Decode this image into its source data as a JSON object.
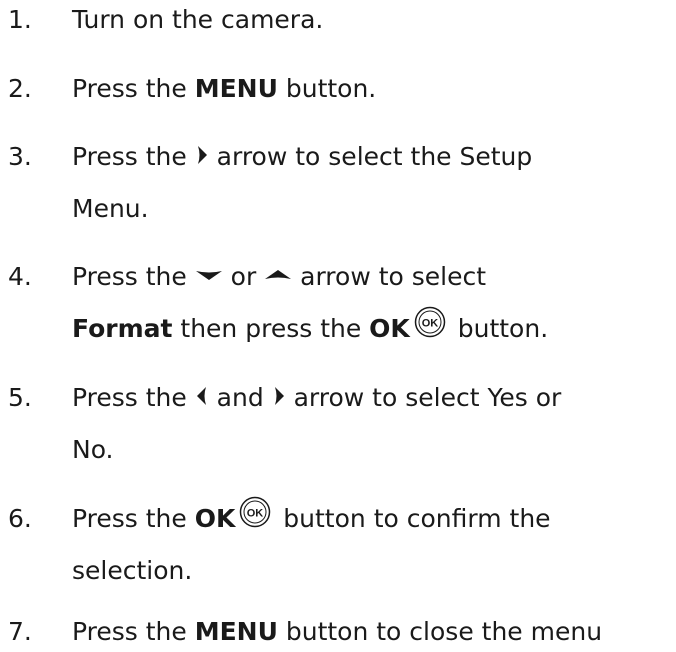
{
  "steps": [
    {
      "num": "1.",
      "line1": "Turn on the camera."
    },
    {
      "num": "2.",
      "pre": "Press the ",
      "bold": "MENU",
      "post": " button."
    },
    {
      "num": "3.",
      "pre": "Press the ",
      "post": " arrow to select the Setup",
      "line2": "Menu.",
      "icon": "right-arrow-icon"
    },
    {
      "num": "4.",
      "pre": "Press the ",
      "mid": " or ",
      "post": " arrow to select",
      "l2bold": "Format",
      "l2mid": " then press the ",
      "l2bold2": "OK",
      "l2post": " button.",
      "icons": [
        "down-arrow-icon",
        "up-arrow-icon",
        "ok-button-icon"
      ]
    },
    {
      "num": "5.",
      "pre": "Press the ",
      "mid": " and ",
      "post": " arrow to select Yes or",
      "line2": "No.",
      "icons": [
        "left-arrow-icon",
        "right-arrow-icon"
      ]
    },
    {
      "num": "6.",
      "pre": "Press the ",
      "bold": "OK",
      "post": " button to confirm the",
      "line2": "selection.",
      "icon": "ok-button-icon"
    },
    {
      "num": "7.",
      "pre": "Press the ",
      "bold": "MENU",
      "post": " button to close the menu"
    }
  ],
  "icon_color": "#1a1a1a"
}
